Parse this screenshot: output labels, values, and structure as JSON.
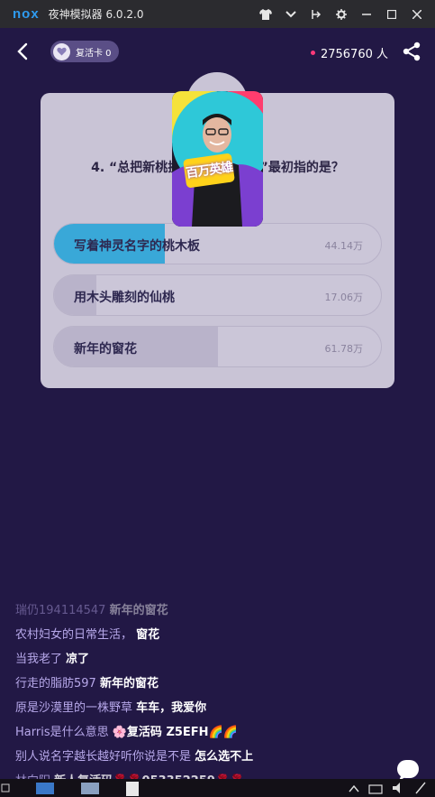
{
  "window": {
    "logo": "nox",
    "title": "夜神模拟器 6.0.2.0",
    "controls": [
      "shirt-icon",
      "chevron-down-icon",
      "pin-icon",
      "gear-icon",
      "minimize-icon",
      "maximize-icon",
      "close-icon"
    ]
  },
  "header": {
    "revive_label": "复活卡 0",
    "viewers": "2756760 人",
    "live_dot_color": "#ff3a7a"
  },
  "question": {
    "text": "4. “总把新桃换旧符”中的“桃”最初指的是？",
    "video_caption": "百万英雄",
    "options": [
      {
        "label": "写着神灵名字的桃木板",
        "count": "44.14万",
        "share": 0.34,
        "fill": "#39a8d8"
      },
      {
        "label": "用木头雕刻的仙桃",
        "count": "17.06万",
        "share": 0.13,
        "fill": "#b9b3ca"
      },
      {
        "label": "新年的窗花",
        "count": "61.78万",
        "share": 0.5,
        "fill": "#b9b3ca"
      }
    ]
  },
  "comments": [
    {
      "user": "瑞仍194114547",
      "msg": "新年的窗花"
    },
    {
      "user": "农村妇女的日常生活，",
      "msg": "窗花"
    },
    {
      "user": "当我老了",
      "msg": "凉了"
    },
    {
      "user": "行走的脂肪597",
      "msg": "新年的窗花"
    },
    {
      "user": "原是沙漠里的一株野草",
      "msg": "车车，我爱你"
    },
    {
      "user": "Harris是什么意思",
      "msg": "🌸复活码 Z5EFH🌈🌈"
    },
    {
      "user": "别人说名字越长越好听你说是不是",
      "msg": "怎么选不上"
    },
    {
      "user": "林向阳",
      "msg": "新人复活码🌹🌹053352259🌹🌹"
    }
  ],
  "colors": {
    "background": "#221845",
    "card": "#c9c4d6",
    "accent": "#39a8d8",
    "username": "#b7a8ea"
  }
}
